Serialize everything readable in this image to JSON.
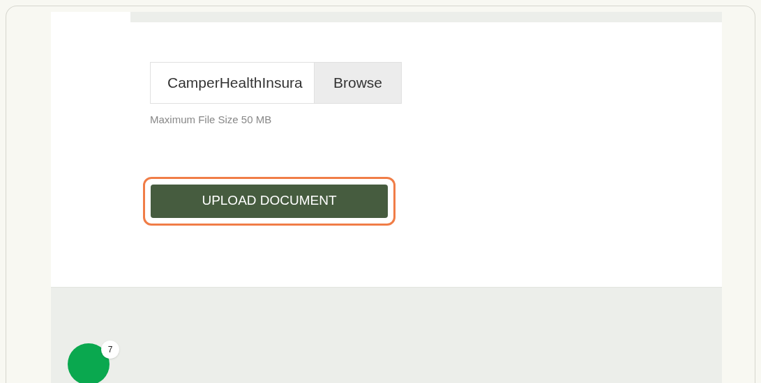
{
  "file_input": {
    "value": "CamperHealthInsura",
    "button": "Browse"
  },
  "hint": "Maximum File Size 50 MB",
  "upload_button": {
    "label": "UPLOAD DOCUMENT",
    "highlighted": true
  },
  "step_badge": "7"
}
